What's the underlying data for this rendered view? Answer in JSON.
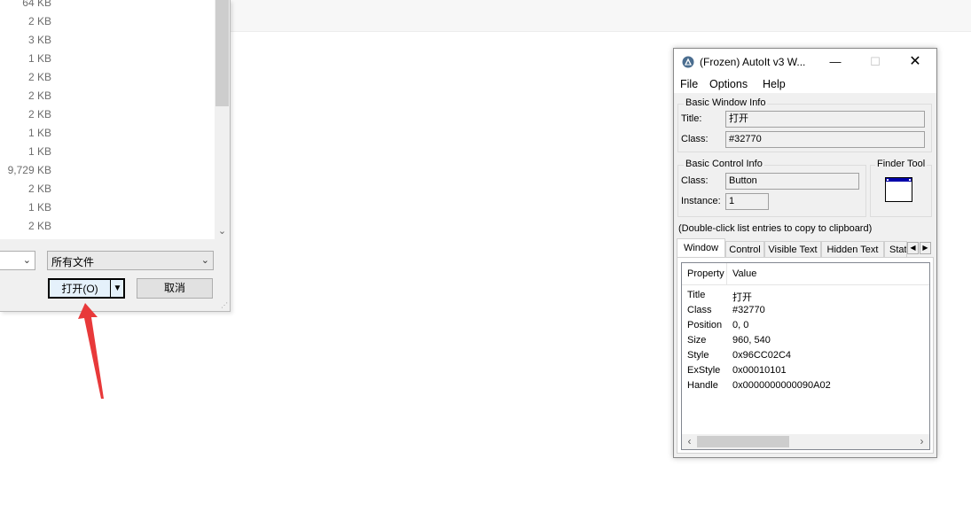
{
  "file_dialog": {
    "sizes": [
      "64 KB",
      "2 KB",
      "3 KB",
      "1 KB",
      "2 KB",
      "2 KB",
      "2 KB",
      "1 KB",
      "1 KB",
      "9,729 KB",
      "2 KB",
      "1 KB",
      "2 KB"
    ],
    "filename_combo": "",
    "filter_combo": "所有文件",
    "open_button": "打开(O)",
    "cancel_button": "取消"
  },
  "autoit": {
    "title": "(Frozen) AutoIt v3 W...",
    "menu": [
      "File",
      "Options",
      "Help"
    ],
    "basic_window_info": {
      "group_label": "Basic Window Info",
      "title_label": "Title:",
      "title_value": "打开",
      "class_label": "Class:",
      "class_value": "#32770"
    },
    "basic_control_info": {
      "group_label": "Basic Control Info",
      "class_label": "Class:",
      "class_value": "Button",
      "instance_label": "Instance:",
      "instance_value": "1"
    },
    "finder_tool_label": "Finder Tool",
    "hint": "(Double-click list entries to copy to clipboard)",
    "tabs": [
      "Window",
      "Control",
      "Visible Text",
      "Hidden Text",
      "Stat"
    ],
    "active_tab": "Window",
    "list_header": [
      "Property",
      "Value"
    ],
    "rows": [
      {
        "property": "Title",
        "value": "打开"
      },
      {
        "property": "Class",
        "value": "#32770"
      },
      {
        "property": "Position",
        "value": "0, 0"
      },
      {
        "property": "Size",
        "value": "960, 540"
      },
      {
        "property": "Style",
        "value": "0x96CC02C4"
      },
      {
        "property": "ExStyle",
        "value": "0x00010101"
      },
      {
        "property": "Handle",
        "value": "0x0000000000090A02"
      }
    ]
  },
  "colors": {
    "annotation_arrow": "#e8393a",
    "finder_titlebar": "#0000aa"
  }
}
